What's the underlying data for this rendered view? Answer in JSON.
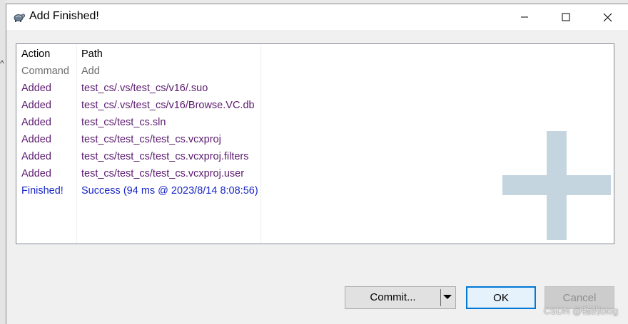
{
  "window": {
    "title": "Add Finished!"
  },
  "list": {
    "columns": [
      "Action",
      "Path"
    ],
    "rows": [
      {
        "action": "Command",
        "path": "Add",
        "kind": "command"
      },
      {
        "action": "Added",
        "path": "test_cs/.vs/test_cs/v16/.suo",
        "kind": "added"
      },
      {
        "action": "Added",
        "path": "test_cs/.vs/test_cs/v16/Browse.VC.db",
        "kind": "added"
      },
      {
        "action": "Added",
        "path": "test_cs/test_cs.sln",
        "kind": "added"
      },
      {
        "action": "Added",
        "path": "test_cs/test_cs/test_cs.vcxproj",
        "kind": "added"
      },
      {
        "action": "Added",
        "path": "test_cs/test_cs/test_cs.vcxproj.filters",
        "kind": "added"
      },
      {
        "action": "Added",
        "path": "test_cs/test_cs/test_cs.vcxproj.user",
        "kind": "added"
      },
      {
        "action": "Finished!",
        "path": "Success (94 ms @ 2023/8/14 8:08:56)",
        "kind": "finished"
      }
    ]
  },
  "buttons": {
    "commit": "Commit...",
    "ok": "OK",
    "cancel": "Cancel"
  },
  "credit": "CSDN @畅的blog",
  "colors": {
    "command": "#6d6d6d",
    "added": "#5b1a6f",
    "finished": "#1a27c6",
    "watermark": "#c5d5e0",
    "focus_border": "#0078d7"
  },
  "icons": {
    "app": "tortoise-icon",
    "minimize": "minimize-icon",
    "maximize": "maximize-icon",
    "close": "close-icon",
    "dropdown": "chevron-down-icon",
    "watermark": "plus-icon"
  }
}
